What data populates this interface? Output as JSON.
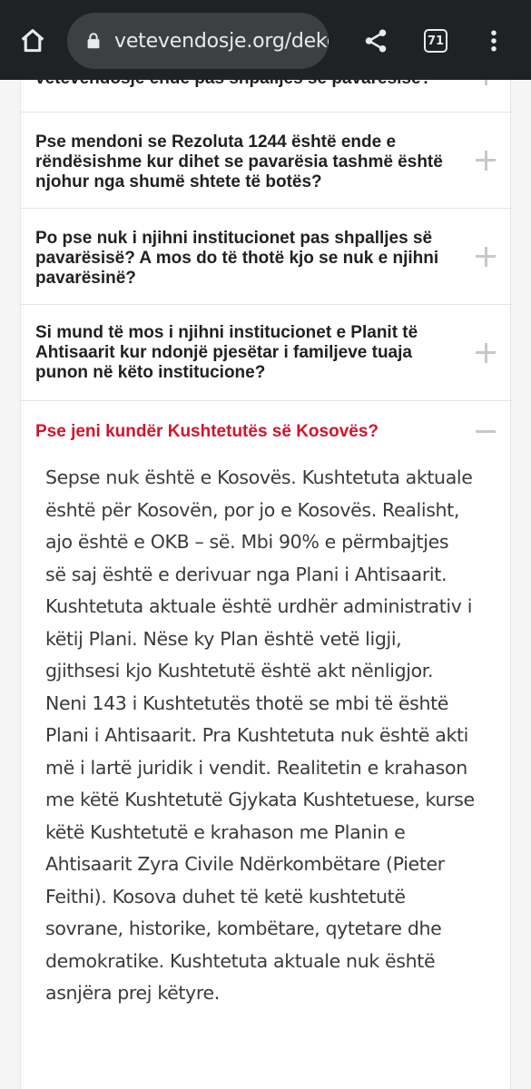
{
  "browser": {
    "url": "vetevendosje.org/deko",
    "tab_count": "71"
  },
  "faq": {
    "items": [
      {
        "question": "vetevendosje ende pas shpalljes së pavarësisë?"
      },
      {
        "question": "Pse mendoni se Rezoluta 1244 është ende e rëndësishme kur dihet se pavarësia tashmë është njohur nga shumë shtete të botës?",
        "lines": [
          "Pse mendoni se Rezoluta 1244 është ende e",
          "rëndësishme kur dihet se pavarësia tashmë është",
          "njohur nga shumë shtete të botës?"
        ]
      },
      {
        "question": "Po pse nuk i njihni institucionet pas shpalljes së pavarësisë? A mos do të thotë kjo se nuk e njihni pavarësinë?",
        "lines": [
          "Po pse nuk i njihni institucionet pas shpalljes së",
          "pavarësisë? A mos do të thotë kjo se nuk e njihni",
          "pavarësinë?"
        ]
      },
      {
        "question": "Si mund të mos i njihni institucionet e Planit të Ahtisaarit kur ndonjë pjesëtar i familjeve tuaja punon në këto institucione?",
        "lines": [
          "Si mund të mos i njihni institucionet e Planit të",
          "Ahtisaarit kur ndonjë pjesëtar i familjeve tuaja",
          "punon në këto institucione?"
        ]
      },
      {
        "question": "Pse jeni kundër Kushtetutës së Kosovës?"
      }
    ],
    "answer_lines": [
      "Sepse nuk është e Kosovës. Kushtetuta aktuale",
      "është për Kosovën, por jo e Kosovës. Realisht,",
      "ajo është e OKB – së. Mbi 90% e përmbajtjes",
      "së saj është e derivuar nga Plani i Ahtisaarit.",
      "Kushtetuta aktuale është urdhër administrativ i",
      "këtij Plani. Nëse ky Plan është vetë ligji,",
      "gjithsesi kjo Kushtetutë është akt nënligjor.",
      "Neni 143 i Kushtetutës thotë se mbi të është",
      "Plani i Ahtisaarit. Pra Kushtetuta nuk është akti",
      "më i lartë juridik i vendit. Realitetin e krahason",
      "me këtë Kushtetutë Gjykata Kushtetuese, kurse",
      "këtë Kushtetutë e krahason me Planin e",
      "Ahtisaarit Zyra Civile Ndërkombëtare (Pieter",
      "Feithi). Kosova duhet të ketë kushtetutë",
      "sovrane, historike, kombëtare, qytetare dhe",
      "demokratike. Kushtetuta aktuale nuk është",
      "asnjëra prej këtyre."
    ]
  },
  "colors": {
    "accent": "#d2142f",
    "toolbar": "#202124",
    "toggle": "#c8c8c8"
  }
}
